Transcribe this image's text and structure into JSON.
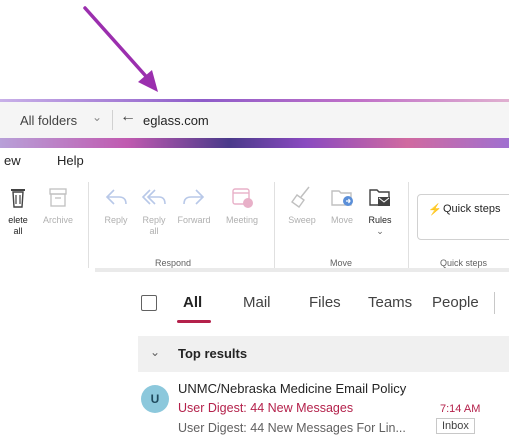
{
  "annotation": {
    "color": "#9b2fae"
  },
  "search": {
    "scope_label": "All folders",
    "query": "eglass.com"
  },
  "menu": {
    "view_label": "ew",
    "help_label": "Help"
  },
  "ribbon": {
    "buttons": [
      {
        "label": "elete",
        "sub": "all",
        "icon": "trash-icon"
      },
      {
        "label": "Archive",
        "icon": "archive-icon"
      },
      {
        "label": "Reply",
        "icon": "reply-icon"
      },
      {
        "label": "Reply",
        "sub": "all",
        "icon": "reply-all-icon"
      },
      {
        "label": "Forward",
        "icon": "forward-icon"
      },
      {
        "label": "Meeting",
        "icon": "meeting-icon"
      },
      {
        "label": "Sweep",
        "icon": "sweep-icon"
      },
      {
        "label": "Move",
        "icon": "move-icon"
      },
      {
        "label": "Rules",
        "icon": "rules-icon"
      }
    ],
    "groups": {
      "respond": "Respond",
      "move": "Move",
      "quick_steps": "Quick steps"
    },
    "quick_steps_button": "Quick steps"
  },
  "tabs": [
    "All",
    "Mail",
    "Files",
    "Teams",
    "People"
  ],
  "active_tab": "All",
  "results": {
    "section_title": "Top results",
    "emails": [
      {
        "avatar_initial": "U",
        "sender": "UNMC/Nebraska Medicine Email Policy",
        "subject": "User Digest: 44 New Messages",
        "time": "7:14 AM",
        "preview": "User Digest: 44 New Messages For Lin...",
        "folder": "Inbox"
      }
    ]
  },
  "colors": {
    "accent": "#b4214b",
    "avatar": "#8cc8dc"
  }
}
